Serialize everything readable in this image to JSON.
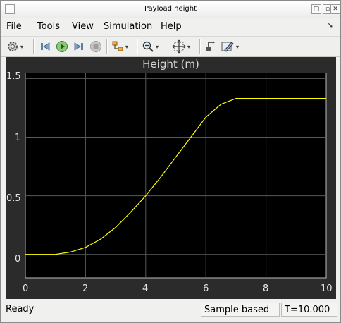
{
  "window": {
    "title": "Payload height"
  },
  "menu": {
    "items": [
      "File",
      "Tools",
      "View",
      "Simulation",
      "Help"
    ]
  },
  "toolbar": {
    "icons": [
      "gear-icon",
      "step-back-icon",
      "run-icon",
      "step-forward-icon",
      "stop-icon",
      "signal-select-icon",
      "zoom-icon",
      "fit-to-view-icon",
      "highlight-icon",
      "style-icon"
    ]
  },
  "plot": {
    "title": "Height (m)",
    "xticks": [
      "0",
      "2",
      "4",
      "6",
      "8",
      "10"
    ],
    "yticks": [
      "1.5",
      "1",
      "0.5",
      "0"
    ],
    "line_color": "#ffff00",
    "background": "#000000",
    "grid_color": "#5a5a5a"
  },
  "chart_data": {
    "type": "line",
    "title": "Height (m)",
    "xlabel": "",
    "ylabel": "",
    "xlim": [
      0,
      10
    ],
    "ylim": [
      -0.2,
      1.55
    ],
    "grid": true,
    "series": [
      {
        "x": [
          0,
          1,
          1.5,
          2,
          2.5,
          3,
          3.5,
          4,
          4.5,
          5,
          5.5,
          6,
          6.5,
          7,
          8,
          9,
          10
        ],
        "values": [
          0,
          0,
          0.02,
          0.06,
          0.13,
          0.23,
          0.36,
          0.5,
          0.66,
          0.83,
          1.0,
          1.17,
          1.28,
          1.33,
          1.33,
          1.33,
          1.33
        ]
      }
    ]
  },
  "status": {
    "ready": "Ready",
    "mode": "Sample based",
    "time": "T=10.000"
  }
}
